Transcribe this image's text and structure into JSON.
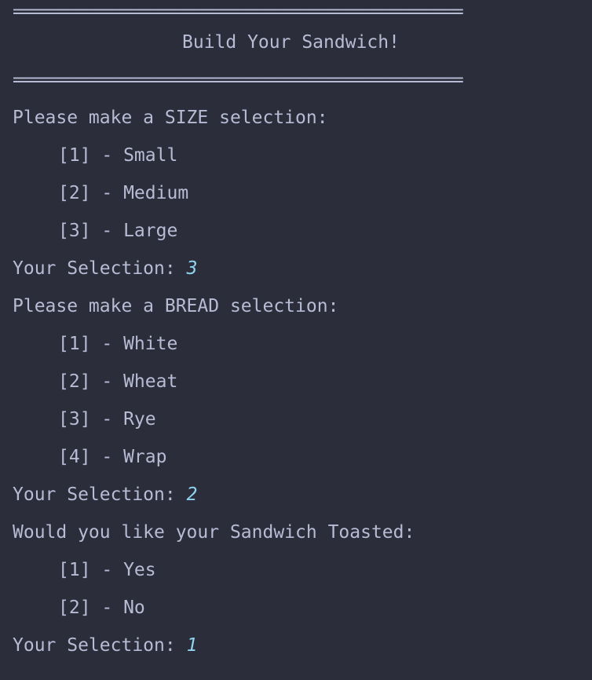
{
  "separator": "==================================================",
  "title": "Build Your Sandwich!",
  "size_section": {
    "prompt": "Please make a SIZE selection:",
    "options": [
      "[1] - Small",
      "[2] - Medium",
      "[3] - Large"
    ],
    "selection_label": "Your Selection: ",
    "selection_value": "3"
  },
  "bread_section": {
    "prompt": "Please make a BREAD selection:",
    "options": [
      "[1] - White",
      "[2] - Wheat",
      "[3] - Rye",
      "[4] - Wrap"
    ],
    "selection_label": "Your Selection: ",
    "selection_value": "2"
  },
  "toast_section": {
    "prompt": "Would you like your Sandwich Toasted:",
    "options": [
      "[1] - Yes",
      "[2] - No"
    ],
    "selection_label": "Your Selection: ",
    "selection_value": "1"
  },
  "colors": {
    "background": "#2b2d3a",
    "text": "#b7bcd4",
    "user_input": "#8fd3ef"
  }
}
